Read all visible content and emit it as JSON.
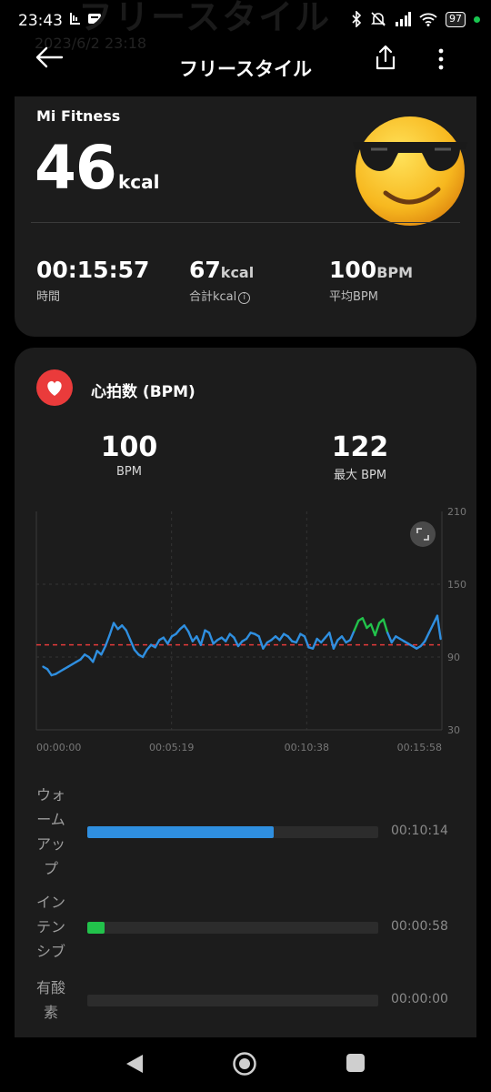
{
  "status_bar": {
    "time": "23:43",
    "battery": "97",
    "colors": {
      "dot": "#19c650"
    }
  },
  "ghost": {
    "title": "フリースタイル",
    "date": "2023/6/2 23:18"
  },
  "header": {
    "title": "フリースタイル"
  },
  "summary": {
    "app_name": "Mi Fitness",
    "calories": "46",
    "calories_unit": "kcal",
    "stats": [
      {
        "value": "00:15:57",
        "unit": "",
        "label": "時間"
      },
      {
        "value": "67",
        "unit": "kcal",
        "label": "合計kcal"
      },
      {
        "value": "100",
        "unit": "BPM",
        "label": "平均BPM"
      }
    ],
    "info_glyph": "i"
  },
  "heart_rate": {
    "title": "心拍数 (BPM)",
    "average": {
      "value": "100",
      "label": "BPM"
    },
    "max": {
      "value": "122",
      "label": "最大 BPM"
    }
  },
  "chart_data": {
    "type": "line",
    "x_ticks": [
      "00:00:00",
      "00:05:19",
      "00:10:38",
      "00:15:58"
    ],
    "y_ticks": [
      "210",
      "150",
      "90",
      "30"
    ],
    "ylim": [
      30,
      210
    ],
    "xlim": [
      0,
      958
    ],
    "reference_line": 100,
    "x": [
      0,
      10,
      20,
      30,
      40,
      50,
      60,
      70,
      80,
      90,
      100,
      110,
      120,
      130,
      140,
      150,
      160,
      170,
      180,
      190,
      200,
      210,
      220,
      230,
      240,
      250,
      260,
      270,
      280,
      290,
      300,
      310,
      320,
      330,
      340,
      350,
      360,
      370,
      380,
      390,
      400,
      410,
      420,
      430,
      440,
      450,
      460,
      470,
      480,
      490,
      500,
      510,
      520,
      530,
      540,
      550,
      560,
      570,
      580,
      590,
      600,
      610,
      620,
      630,
      640,
      650,
      660,
      670,
      680,
      690,
      700,
      710,
      720,
      730,
      740,
      750,
      760,
      770,
      780,
      790,
      800,
      810,
      820,
      830,
      840,
      850,
      860,
      870,
      880,
      890,
      900,
      910,
      920,
      930,
      940,
      950,
      958
    ],
    "y": [
      82,
      80,
      75,
      76,
      78,
      80,
      82,
      84,
      86,
      88,
      92,
      90,
      86,
      95,
      92,
      99,
      108,
      118,
      113,
      116,
      112,
      104,
      96,
      92,
      90,
      96,
      100,
      98,
      104,
      106,
      101,
      107,
      109,
      113,
      116,
      111,
      103,
      107,
      100,
      112,
      110,
      101,
      104,
      106,
      103,
      109,
      106,
      99,
      103,
      105,
      110,
      109,
      107,
      97,
      102,
      104,
      107,
      104,
      109,
      107,
      103,
      102,
      109,
      107,
      98,
      97,
      105,
      102,
      106,
      110,
      97,
      104,
      107,
      102,
      104,
      112,
      120,
      122,
      114,
      117,
      108,
      118,
      121,
      110,
      102,
      107,
      105,
      103,
      101,
      99,
      97,
      99,
      103,
      110,
      117,
      124,
      105
    ],
    "series_colors": {
      "normal": "#2f8fe0",
      "high": "#22c24b",
      "reference": "#e23a3a"
    },
    "high_threshold": 113,
    "high_from_index": 75
  },
  "zones": [
    {
      "label": [
        "ウォ",
        "ーム",
        "アッ",
        "プ"
      ],
      "time": "00:10:14",
      "fraction": 0.64,
      "color": "#2f8fe0"
    },
    {
      "label": [
        "イン",
        "テン",
        "シブ"
      ],
      "time": "00:00:58",
      "fraction": 0.06,
      "color": "#22c24b"
    },
    {
      "label": [
        "有酸",
        "素"
      ],
      "time": "00:00:00",
      "fraction": 0,
      "color": "#2c2c2c"
    }
  ]
}
